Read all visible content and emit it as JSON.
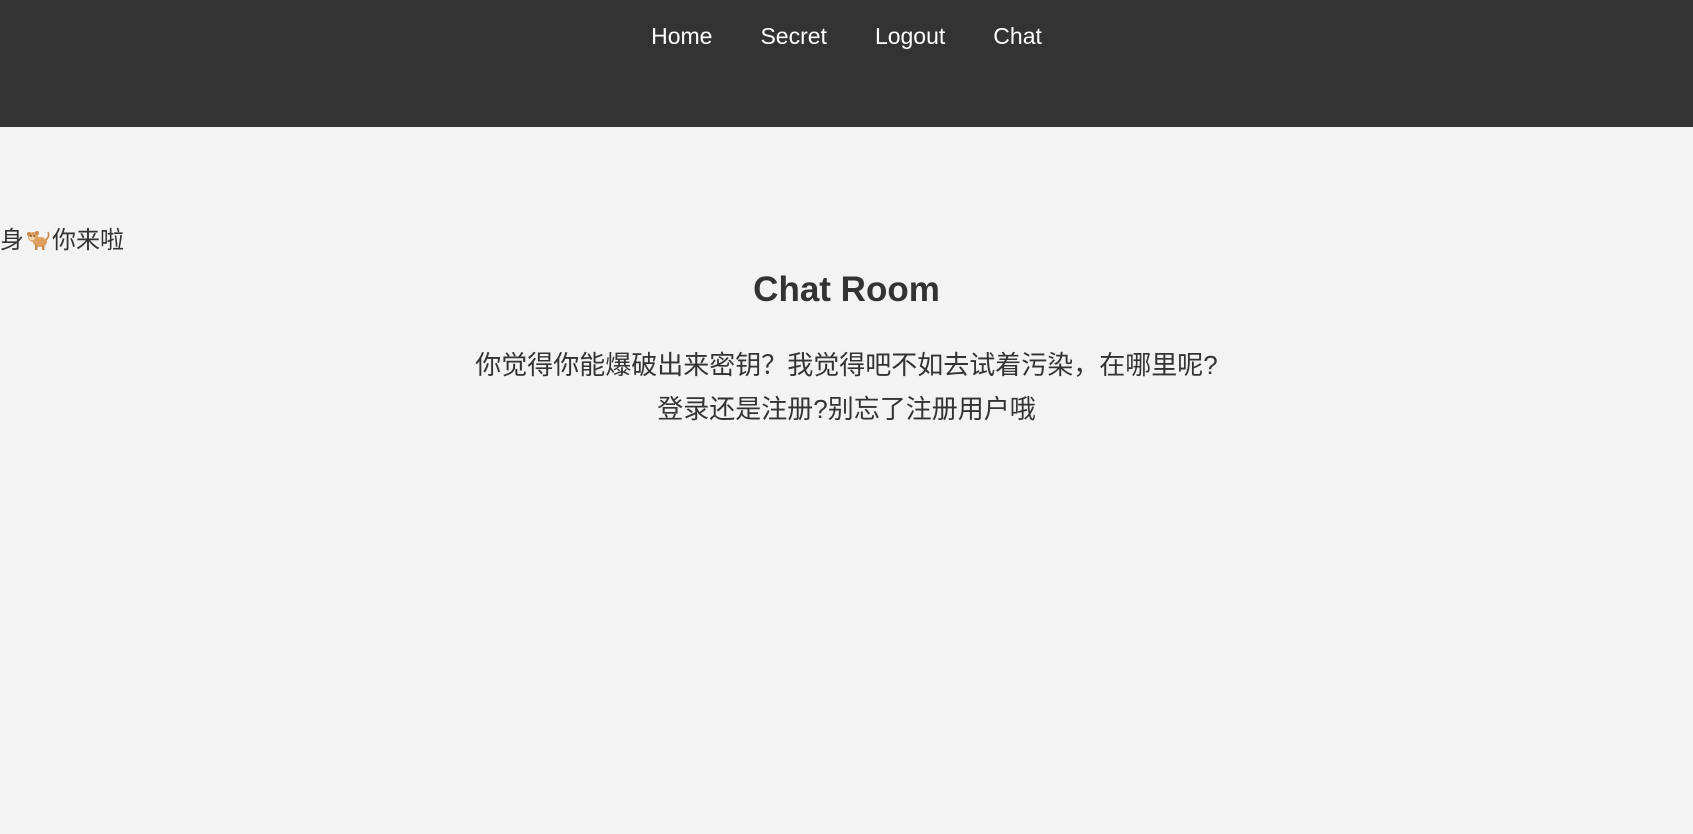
{
  "nav": {
    "items": [
      {
        "label": "Home"
      },
      {
        "label": "Secret"
      },
      {
        "label": "Logout"
      },
      {
        "label": "Chat"
      }
    ]
  },
  "marquee": {
    "prefix": "身",
    "emoji_icon": "monkey-icon",
    "suffix": "你来啦"
  },
  "main": {
    "title": "Chat Room",
    "line1": "你觉得你能爆破出来密钥？我觉得吧不如去试着污染，在哪里呢?",
    "line2": "登录还是注册?别忘了注册用户哦"
  },
  "colors": {
    "header_bg": "#333333",
    "page_bg": "#f3f3f3",
    "text": "#333333",
    "nav_text": "#ffffff",
    "monkey": "#e0a060"
  }
}
